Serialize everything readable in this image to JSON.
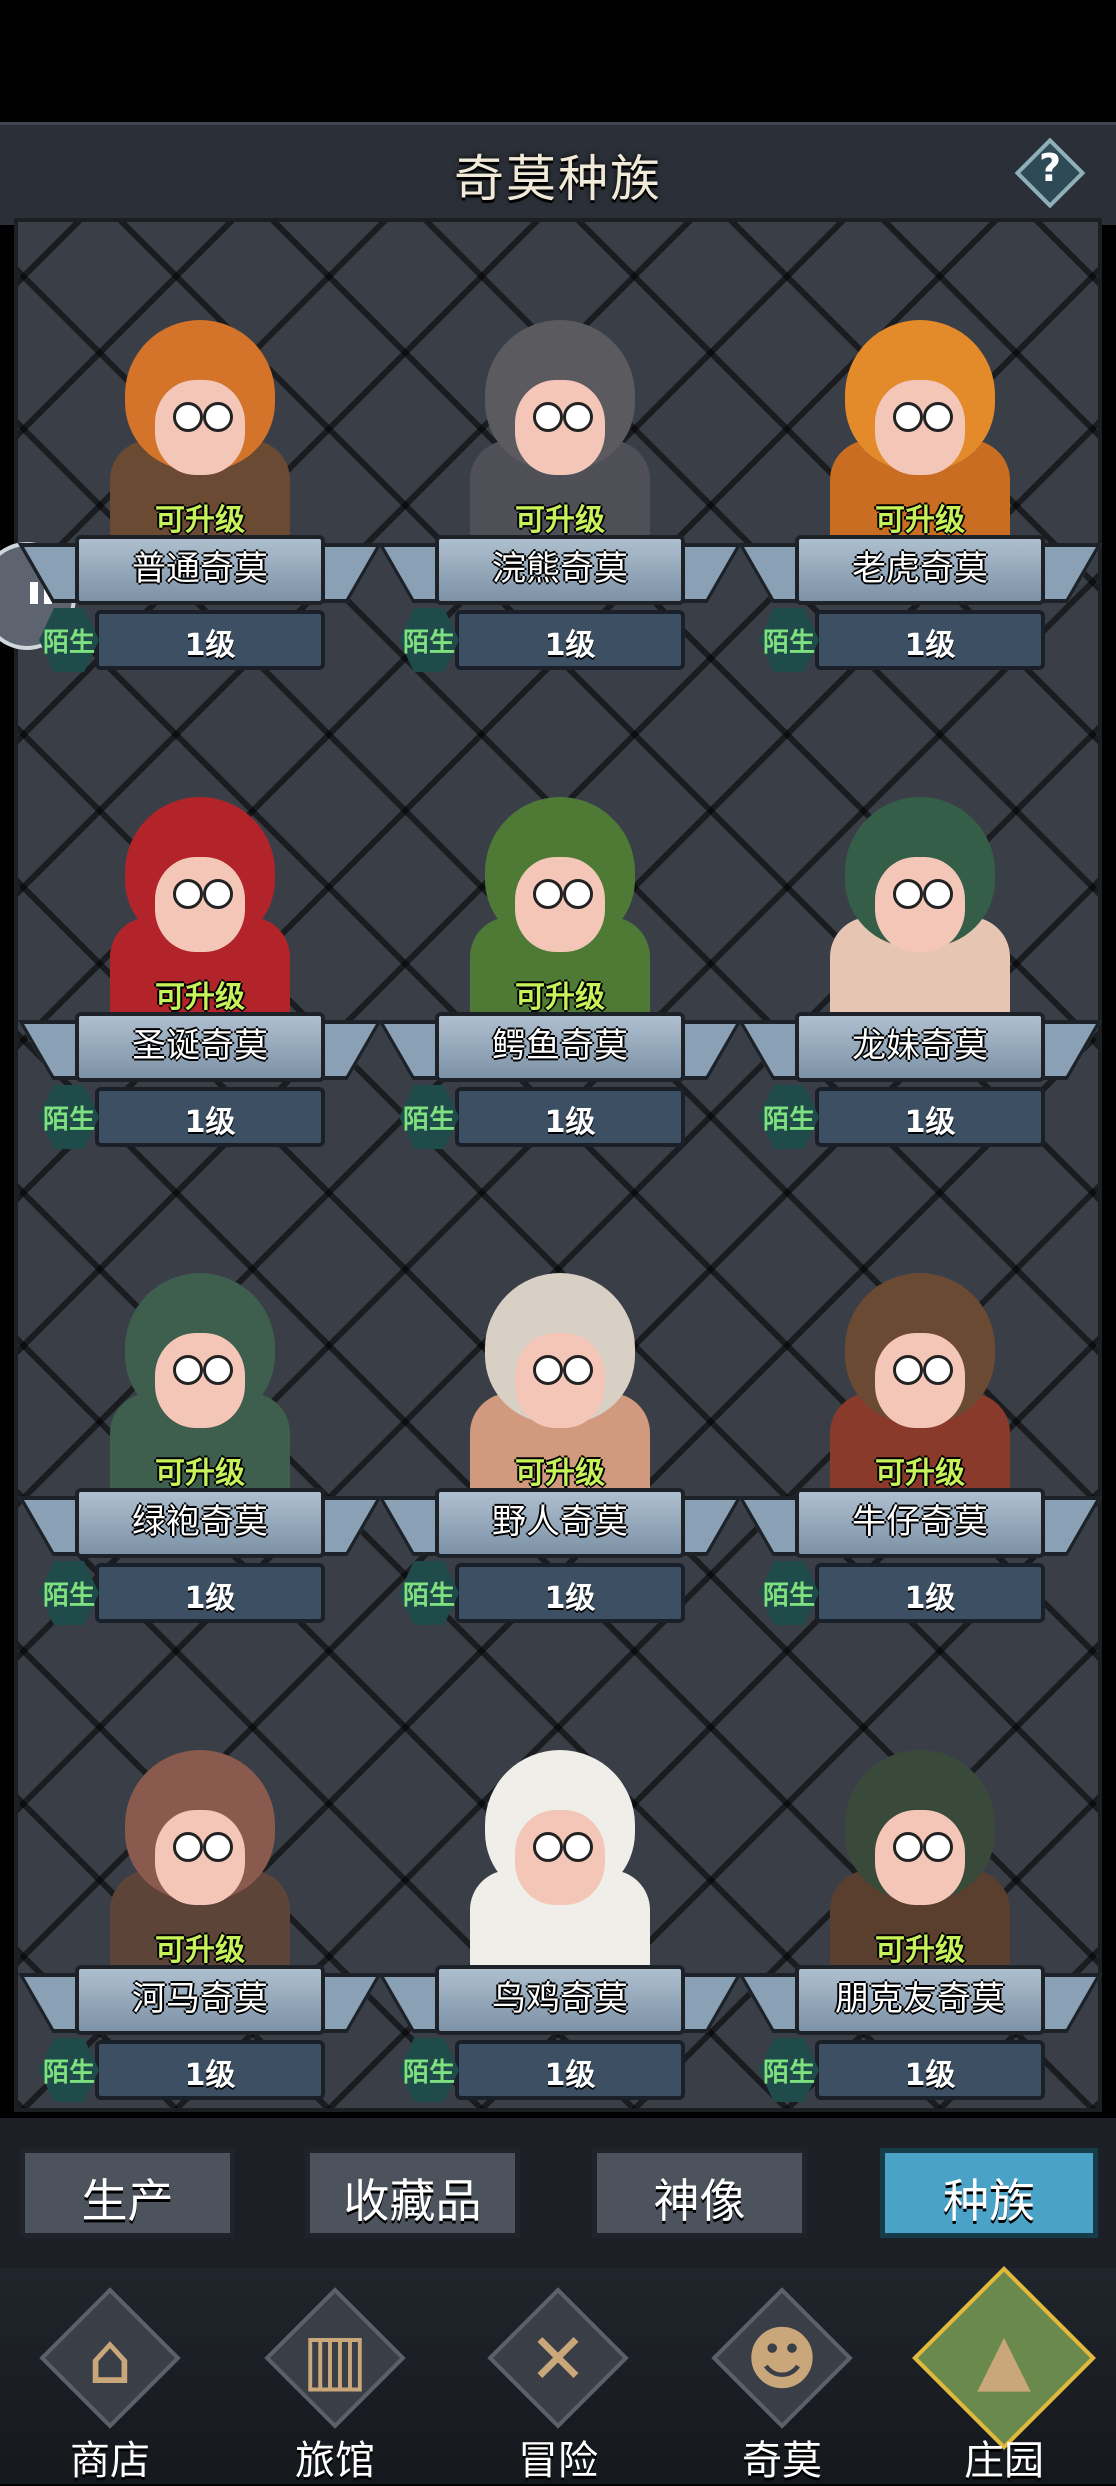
{
  "header": {
    "title": "奇莫种族",
    "help_glyph": "?"
  },
  "cards": [
    {
      "name": "普通奇莫",
      "upgrade": "可升级",
      "status": "陌生",
      "level": "1级",
      "head_color": "#d4732a",
      "body_color": "#6b4a34"
    },
    {
      "name": "浣熊奇莫",
      "upgrade": "可升级",
      "status": "陌生",
      "level": "1级",
      "head_color": "#5b5b5f",
      "body_color": "#4e4f57"
    },
    {
      "name": "老虎奇莫",
      "upgrade": "可升级",
      "status": "陌生",
      "level": "1级",
      "head_color": "#e38a2a",
      "body_color": "#c96d22"
    },
    {
      "name": "圣诞奇莫",
      "upgrade": "可升级",
      "status": "陌生",
      "level": "1级",
      "head_color": "#b3242a",
      "body_color": "#b3242a"
    },
    {
      "name": "鳄鱼奇莫",
      "upgrade": "可升级",
      "status": "陌生",
      "level": "1级",
      "head_color": "#4f7a35",
      "body_color": "#4f7a35"
    },
    {
      "name": "龙妹奇莫",
      "upgrade": "",
      "status": "陌生",
      "level": "1级",
      "head_color": "#355e48",
      "body_color": "#e6c6b3"
    },
    {
      "name": "绿袍奇莫",
      "upgrade": "可升级",
      "status": "陌生",
      "level": "1级",
      "head_color": "#3e5e4e",
      "body_color": "#3e5e4e"
    },
    {
      "name": "野人奇莫",
      "upgrade": "可升级",
      "status": "陌生",
      "level": "1级",
      "head_color": "#d8d0c4",
      "body_color": "#d19a7e"
    },
    {
      "name": "牛仔奇莫",
      "upgrade": "可升级",
      "status": "陌生",
      "level": "1级",
      "head_color": "#6b4a34",
      "body_color": "#8a3a2a"
    },
    {
      "name": "河马奇莫",
      "upgrade": "可升级",
      "status": "陌生",
      "level": "1级",
      "head_color": "#8a5a4e",
      "body_color": "#5c4438"
    },
    {
      "name": "鸟鸡奇莫",
      "upgrade": "",
      "status": "陌生",
      "level": "1级",
      "head_color": "#f0eee8",
      "body_color": "#f0eee8"
    },
    {
      "name": "朋克友奇莫",
      "upgrade": "可升级",
      "status": "陌生",
      "level": "1级",
      "head_color": "#3a4a3a",
      "body_color": "#5a3e2e"
    }
  ],
  "tabs": [
    "生产",
    "收藏品",
    "神像",
    "种族"
  ],
  "active_tab": "种族",
  "nav": [
    {
      "label": "商店",
      "icon": "shop-icon",
      "glyph": "⌂"
    },
    {
      "label": "旅馆",
      "icon": "inn-gate-icon",
      "glyph": "▥"
    },
    {
      "label": "冒险",
      "icon": "crossed-swords-icon",
      "glyph": "✕"
    },
    {
      "label": "奇莫",
      "icon": "chicken-character-icon",
      "glyph": "☻"
    },
    {
      "label": "庄园",
      "icon": "island-manor-icon",
      "glyph": "▲"
    }
  ],
  "active_nav": "庄园"
}
